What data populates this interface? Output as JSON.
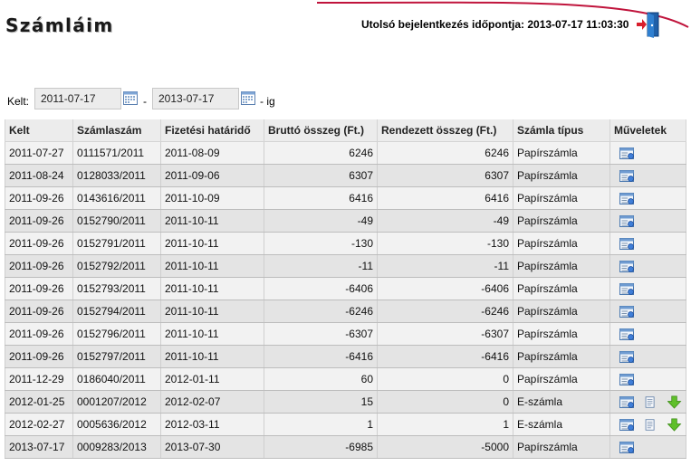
{
  "page": {
    "title": "Számláim"
  },
  "header": {
    "last_login": "Utolsó bejelentkezés időpontja: 2013-07-17 11:03:30",
    "logout_icon": "exit-door-icon"
  },
  "filter": {
    "label": "Kelt:",
    "from": "2011-07-17",
    "separator": "-",
    "to": "2013-07-17",
    "suffix": "- ig"
  },
  "table": {
    "columns": [
      "Kelt",
      "Számlaszám",
      "Fizetési határidő",
      "Bruttó összeg (Ft.)",
      "Rendezett összeg (Ft.)",
      "Számla típus",
      "Műveletek"
    ],
    "rows": [
      {
        "kelt": "2011-07-27",
        "szam": "0111571/2011",
        "hatarido": "2011-08-09",
        "brutto": "6246",
        "rendezett": "6246",
        "tipus": "Papírszámla",
        "actions": [
          "view"
        ]
      },
      {
        "kelt": "2011-08-24",
        "szam": "0128033/2011",
        "hatarido": "2011-09-06",
        "brutto": "6307",
        "rendezett": "6307",
        "tipus": "Papírszámla",
        "actions": [
          "view"
        ]
      },
      {
        "kelt": "2011-09-26",
        "szam": "0143616/2011",
        "hatarido": "2011-10-09",
        "brutto": "6416",
        "rendezett": "6416",
        "tipus": "Papírszámla",
        "actions": [
          "view"
        ]
      },
      {
        "kelt": "2011-09-26",
        "szam": "0152790/2011",
        "hatarido": "2011-10-11",
        "brutto": "-49",
        "rendezett": "-49",
        "tipus": "Papírszámla",
        "actions": [
          "view"
        ]
      },
      {
        "kelt": "2011-09-26",
        "szam": "0152791/2011",
        "hatarido": "2011-10-11",
        "brutto": "-130",
        "rendezett": "-130",
        "tipus": "Papírszámla",
        "actions": [
          "view"
        ]
      },
      {
        "kelt": "2011-09-26",
        "szam": "0152792/2011",
        "hatarido": "2011-10-11",
        "brutto": "-11",
        "rendezett": "-11",
        "tipus": "Papírszámla",
        "actions": [
          "view"
        ]
      },
      {
        "kelt": "2011-09-26",
        "szam": "0152793/2011",
        "hatarido": "2011-10-11",
        "brutto": "-6406",
        "rendezett": "-6406",
        "tipus": "Papírszámla",
        "actions": [
          "view"
        ]
      },
      {
        "kelt": "2011-09-26",
        "szam": "0152794/2011",
        "hatarido": "2011-10-11",
        "brutto": "-6246",
        "rendezett": "-6246",
        "tipus": "Papírszámla",
        "actions": [
          "view"
        ]
      },
      {
        "kelt": "2011-09-26",
        "szam": "0152796/2011",
        "hatarido": "2011-10-11",
        "brutto": "-6307",
        "rendezett": "-6307",
        "tipus": "Papírszámla",
        "actions": [
          "view"
        ]
      },
      {
        "kelt": "2011-09-26",
        "szam": "0152797/2011",
        "hatarido": "2011-10-11",
        "brutto": "-6416",
        "rendezett": "-6416",
        "tipus": "Papírszámla",
        "actions": [
          "view"
        ]
      },
      {
        "kelt": "2011-12-29",
        "szam": "0186040/2011",
        "hatarido": "2012-01-11",
        "brutto": "60",
        "rendezett": "0",
        "tipus": "Papírszámla",
        "actions": [
          "view"
        ]
      },
      {
        "kelt": "2012-01-25",
        "szam": "0001207/2012",
        "hatarido": "2012-02-07",
        "brutto": "15",
        "rendezett": "0",
        "tipus": "E-számla",
        "actions": [
          "view",
          "document",
          "download"
        ]
      },
      {
        "kelt": "2012-02-27",
        "szam": "0005636/2012",
        "hatarido": "2012-03-11",
        "brutto": "1",
        "rendezett": "1",
        "tipus": "E-számla",
        "actions": [
          "view",
          "document",
          "download"
        ]
      },
      {
        "kelt": "2013-07-17",
        "szam": "0009283/2013",
        "hatarido": "2013-07-30",
        "brutto": "-6985",
        "rendezett": "-5000",
        "tipus": "Papírszámla",
        "actions": [
          "view"
        ]
      }
    ]
  },
  "icons": {
    "view": "invoice-view-icon",
    "document": "document-icon",
    "download": "download-arrow-icon",
    "calendar": "calendar-icon"
  },
  "colors": {
    "accent": "#c0143c",
    "header_bg": "#ececec",
    "row_odd": "#f2f2f2",
    "row_even": "#e4e4e4"
  }
}
